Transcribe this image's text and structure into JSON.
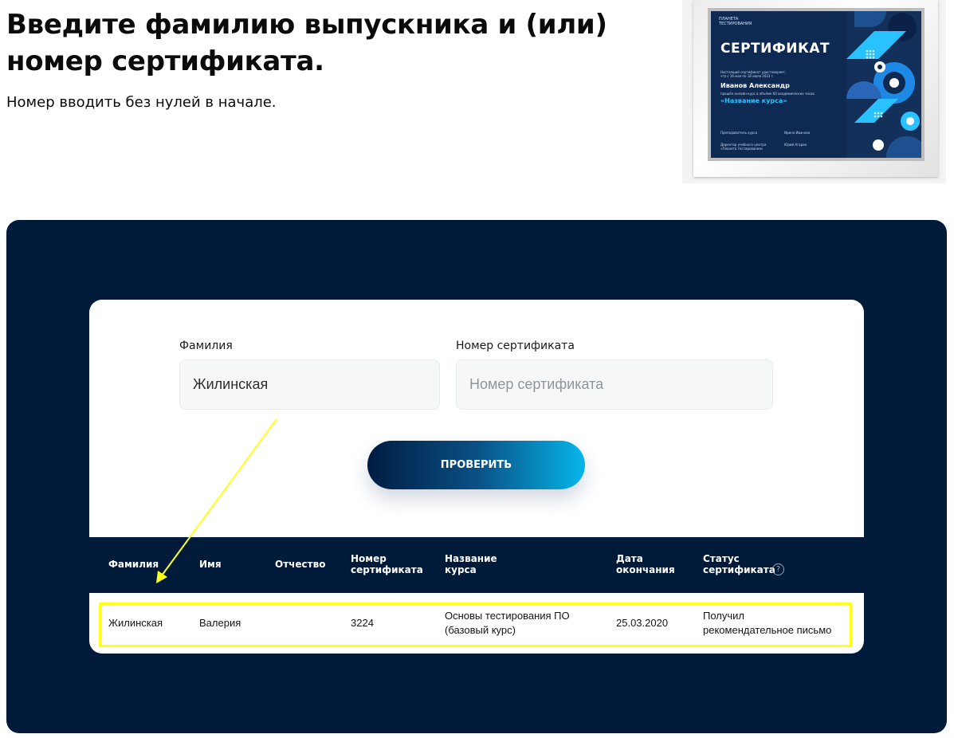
{
  "header": {
    "title": "Введите фамилию выпускника и (или) номер сертификата.",
    "hint": "Номер вводить без нулей в начале."
  },
  "certificate_preview": {
    "logo": "ПЛАНЕТА\nТЕСТИРОВАНИЯ",
    "heading": "СЕРТИФИКАТ",
    "intro": "Настоящий сертификат удостоверяет,\nчто с 16 мая по 18 июля 2023 г.",
    "name": "Иванов Александр",
    "completed": "прошёл онлайн-курс в объёме 60 академических часов",
    "course": "«Название курса»",
    "teacher_label": "Преподаватель курса",
    "director_label": "Директор учебного центра\n«Планета тестирования»",
    "teacher_name": "Ирина Иванова",
    "director_name": "Юрий Агарин",
    "colors": {
      "background": "#0f2a52",
      "accent": "#29c1ff",
      "accent2": "#2196f3"
    }
  },
  "form": {
    "lastname_label": "Фамилия",
    "lastname_value": "Жилинская",
    "cert_label": "Номер сертификата",
    "cert_placeholder": "Номер сертификата",
    "submit_label": "ПРОВЕРИТЬ"
  },
  "table": {
    "headers": {
      "lastname": "Фамилия",
      "firstname": "Имя",
      "patronymic": "Отчество",
      "cert_number": "Номер\nсертификата",
      "course": "Название\nкурса",
      "end_date": "Дата\nокончания",
      "status": "Статус\nсертификата",
      "help": "?"
    },
    "rows": [
      {
        "lastname": "Жилинская",
        "firstname": "Валерия",
        "patronymic": "",
        "cert_number": "3224",
        "course": "Основы тестирования ПО\n(базовый курс)",
        "end_date": "25.03.2020",
        "status": "Получил\nрекомендательное письмо"
      }
    ]
  },
  "annotation": {
    "color": "#ffff1a"
  },
  "theme": {
    "dark": "#001a3a",
    "button_start": "#001d42",
    "button_end": "#05b6ea"
  }
}
